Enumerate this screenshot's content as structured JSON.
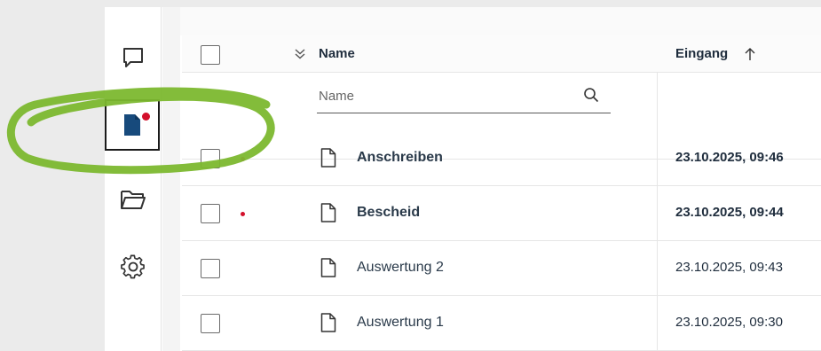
{
  "sidebar": {
    "items": [
      {
        "icon": "chat-bubble-icon",
        "active": false,
        "unread": false
      },
      {
        "icon": "document-icon",
        "active": true,
        "unread": true
      },
      {
        "icon": "folder-icon",
        "active": false,
        "unread": false
      },
      {
        "icon": "gear-icon",
        "active": false,
        "unread": false
      }
    ]
  },
  "table": {
    "columns": {
      "name": {
        "label": "Name"
      },
      "eingang": {
        "label": "Eingang",
        "sort": "ascending"
      }
    },
    "filter": {
      "name_placeholder": "Name",
      "name_value": ""
    },
    "rows": [
      {
        "name": "Anschreiben",
        "date": "23.10.2025, 09:46",
        "unread": true
      },
      {
        "name": "Bescheid",
        "date": "23.10.2025, 09:44",
        "unread": true
      },
      {
        "name": "Auswertung 2",
        "date": "23.10.2025, 09:43",
        "unread": false
      },
      {
        "name": "Auswertung 1",
        "date": "23.10.2025, 09:30",
        "unread": false
      }
    ]
  },
  "colors": {
    "accent": "#174a7c",
    "unread_dot": "#d3102b",
    "highlight_stroke": "#7cb82f"
  }
}
